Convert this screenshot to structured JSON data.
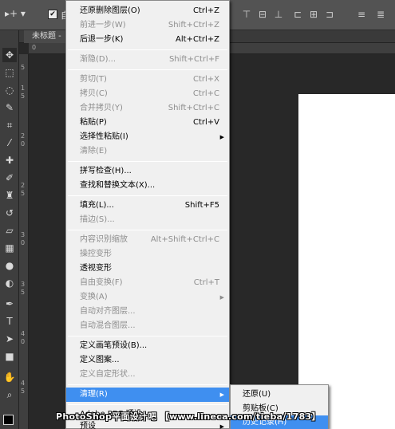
{
  "options_bar": {
    "tool_label": "▸+ ▾",
    "auto_select_check": "✔",
    "auto_select_label": "自"
  },
  "tab": {
    "title": "未标题 -"
  },
  "ruler": {
    "top_left": "0",
    "left": [
      "5",
      "1",
      "5",
      "2",
      "0",
      "2",
      "5",
      "3",
      "0",
      "3",
      "5",
      "4",
      "0",
      "4",
      "5"
    ]
  },
  "menu": {
    "items": [
      {
        "label": "还原删除图层(O)",
        "shortcut": "Ctrl+Z",
        "disabled": false
      },
      {
        "label": "前进一步(W)",
        "shortcut": "Shift+Ctrl+Z",
        "disabled": true
      },
      {
        "label": "后退一步(K)",
        "shortcut": "Alt+Ctrl+Z",
        "disabled": false
      },
      {
        "label": "渐隐(D)...",
        "shortcut": "Shift+Ctrl+F",
        "disabled": true
      },
      {
        "label": "剪切(T)",
        "shortcut": "Ctrl+X",
        "disabled": true
      },
      {
        "label": "拷贝(C)",
        "shortcut": "Ctrl+C",
        "disabled": true
      },
      {
        "label": "合并拷贝(Y)",
        "shortcut": "Shift+Ctrl+C",
        "disabled": true
      },
      {
        "label": "粘贴(P)",
        "shortcut": "Ctrl+V",
        "disabled": false
      },
      {
        "label": "选择性粘贴(I)",
        "shortcut": "",
        "disabled": false,
        "submenu": true
      },
      {
        "label": "清除(E)",
        "shortcut": "",
        "disabled": true
      },
      {
        "label": "拼写检查(H)...",
        "shortcut": "",
        "disabled": false
      },
      {
        "label": "查找和替换文本(X)...",
        "shortcut": "",
        "disabled": false
      },
      {
        "label": "填充(L)...",
        "shortcut": "Shift+F5",
        "disabled": false
      },
      {
        "label": "描边(S)...",
        "shortcut": "",
        "disabled": true
      },
      {
        "label": "内容识别缩放",
        "shortcut": "Alt+Shift+Ctrl+C",
        "disabled": true
      },
      {
        "label": "操控变形",
        "shortcut": "",
        "disabled": true
      },
      {
        "label": "透视变形",
        "shortcut": "",
        "disabled": false
      },
      {
        "label": "自由变换(F)",
        "shortcut": "Ctrl+T",
        "disabled": true
      },
      {
        "label": "变换(A)",
        "shortcut": "",
        "disabled": true,
        "submenu": true
      },
      {
        "label": "自动对齐图层...",
        "shortcut": "",
        "disabled": true
      },
      {
        "label": "自动混合图层...",
        "shortcut": "",
        "disabled": true
      },
      {
        "label": "定义画笔预设(B)...",
        "shortcut": "",
        "disabled": false
      },
      {
        "label": "定义图案...",
        "shortcut": "",
        "disabled": false
      },
      {
        "label": "定义自定形状...",
        "shortcut": "",
        "disabled": true
      },
      {
        "label": "清理(R)",
        "shortcut": "",
        "disabled": false,
        "submenu": true,
        "highlighted": true
      },
      {
        "label": "Adobe PDF 预设...",
        "shortcut": "",
        "disabled": false
      },
      {
        "label": "预设",
        "shortcut": "",
        "disabled": false,
        "submenu": true
      }
    ]
  },
  "submenu": {
    "items": [
      {
        "label": "还原(U)",
        "highlighted": false
      },
      {
        "label": "剪贴板(C)",
        "highlighted": false
      },
      {
        "label": "历史记录(H)",
        "highlighted": true
      }
    ]
  },
  "watermark": "PhotoShop平面设计吧 【www.lineca.com/tieba/1783】",
  "colors": {
    "highlight": "#3f8ff0",
    "menu_bg": "#f0f0f0",
    "workspace": "#282828",
    "panel": "#535353"
  }
}
